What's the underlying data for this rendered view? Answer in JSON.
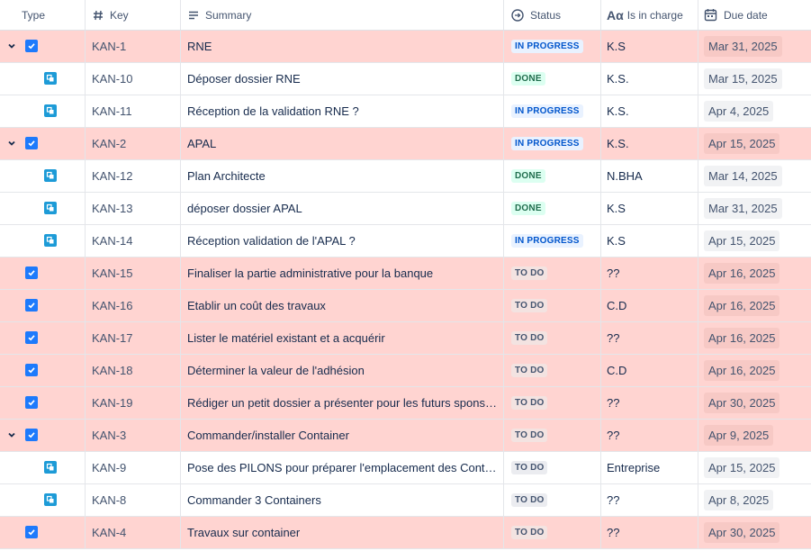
{
  "columns": {
    "type": "Type",
    "key": "Key",
    "summary": "Summary",
    "status": "Status",
    "in_charge": "Is in charge",
    "due_date": "Due date"
  },
  "colors": {
    "highlight_row": "#ffd4d1",
    "checkbox": "#1d7afc",
    "subtask": "#1d9bd7"
  },
  "rows": [
    {
      "kind": "parent",
      "expanded": true,
      "icon": "task-checkbox-icon",
      "key": "KAN-1",
      "summary": "RNE",
      "status": "IN PROGRESS",
      "status_class": "progress",
      "who": "K.S",
      "due": "Mar 31, 2025",
      "highlight": true
    },
    {
      "kind": "child",
      "icon": "subtask-icon",
      "key": "KAN-10",
      "summary": "Déposer dossier RNE",
      "status": "DONE",
      "status_class": "done",
      "who": "K.S.",
      "due": "Mar 15, 2025",
      "highlight": false
    },
    {
      "kind": "child",
      "icon": "subtask-icon",
      "key": "KAN-11",
      "summary": "Réception de la validation RNE ?",
      "status": "IN PROGRESS",
      "status_class": "progress",
      "who": "K.S.",
      "due": "Apr 4, 2025",
      "highlight": false
    },
    {
      "kind": "parent",
      "expanded": true,
      "icon": "task-checkbox-icon",
      "key": "KAN-2",
      "summary": "APAL",
      "status": "IN PROGRESS",
      "status_class": "progress",
      "who": "K.S.",
      "due": "Apr 15, 2025",
      "highlight": true
    },
    {
      "kind": "child",
      "icon": "subtask-icon",
      "key": "KAN-12",
      "summary": "Plan Architecte",
      "status": "DONE",
      "status_class": "done",
      "who": "N.BHA",
      "due": "Mar 14, 2025",
      "highlight": false
    },
    {
      "kind": "child",
      "icon": "subtask-icon",
      "key": "KAN-13",
      "summary": "déposer dossier APAL",
      "status": "DONE",
      "status_class": "done",
      "who": "K.S",
      "due": "Mar 31, 2025",
      "highlight": false
    },
    {
      "kind": "child",
      "icon": "subtask-icon",
      "key": "KAN-14",
      "summary": "Réception validation de l'APAL ?",
      "status": "IN PROGRESS",
      "status_class": "progress",
      "who": "K.S",
      "due": "Apr 15, 2025",
      "highlight": false
    },
    {
      "kind": "task",
      "icon": "task-checkbox-icon",
      "key": "KAN-15",
      "summary": "Finaliser la partie administrative pour la banque",
      "status": "TO DO",
      "status_class": "todo",
      "who": "??",
      "due": "Apr 16, 2025",
      "highlight": true
    },
    {
      "kind": "task",
      "icon": "task-checkbox-icon",
      "key": "KAN-16",
      "summary": "Etablir un coût des travaux",
      "status": "TO DO",
      "status_class": "todo",
      "who": "C.D",
      "due": "Apr 16, 2025",
      "highlight": true
    },
    {
      "kind": "task",
      "icon": "task-checkbox-icon",
      "key": "KAN-17",
      "summary": "Lister le matériel existant et a acquérir",
      "status": "TO DO",
      "status_class": "todo",
      "who": "??",
      "due": "Apr 16, 2025",
      "highlight": true
    },
    {
      "kind": "task",
      "icon": "task-checkbox-icon",
      "key": "KAN-18",
      "summary": "Déterminer la valeur de l'adhésion",
      "status": "TO DO",
      "status_class": "todo",
      "who": "C.D",
      "due": "Apr 16, 2025",
      "highlight": true
    },
    {
      "kind": "task",
      "icon": "task-checkbox-icon",
      "key": "KAN-19",
      "summary": "Rédiger un petit dossier a présenter pour les futurs sponsors ...",
      "status": "TO DO",
      "status_class": "todo",
      "who": "??",
      "due": "Apr 30, 2025",
      "highlight": true
    },
    {
      "kind": "parent",
      "expanded": true,
      "icon": "task-checkbox-icon",
      "key": "KAN-3",
      "summary": "Commander/installer Container",
      "status": "TO DO",
      "status_class": "todo",
      "who": "??",
      "due": "Apr 9, 2025",
      "highlight": true
    },
    {
      "kind": "child",
      "icon": "subtask-icon",
      "key": "KAN-9",
      "summary": "Pose des PILONS pour préparer l'emplacement des Containers",
      "status": "TO DO",
      "status_class": "todo",
      "who": "Entreprise",
      "due": "Apr 15, 2025",
      "highlight": false
    },
    {
      "kind": "child",
      "icon": "subtask-icon",
      "key": "KAN-8",
      "summary": "Commander 3 Containers",
      "status": "TO DO",
      "status_class": "todo",
      "who": "??",
      "due": "Apr 8, 2025",
      "highlight": false
    },
    {
      "kind": "task",
      "icon": "task-checkbox-icon",
      "key": "KAN-4",
      "summary": "Travaux sur container",
      "status": "TO DO",
      "status_class": "todo",
      "who": "??",
      "due": "Apr 30, 2025",
      "highlight": true
    }
  ]
}
